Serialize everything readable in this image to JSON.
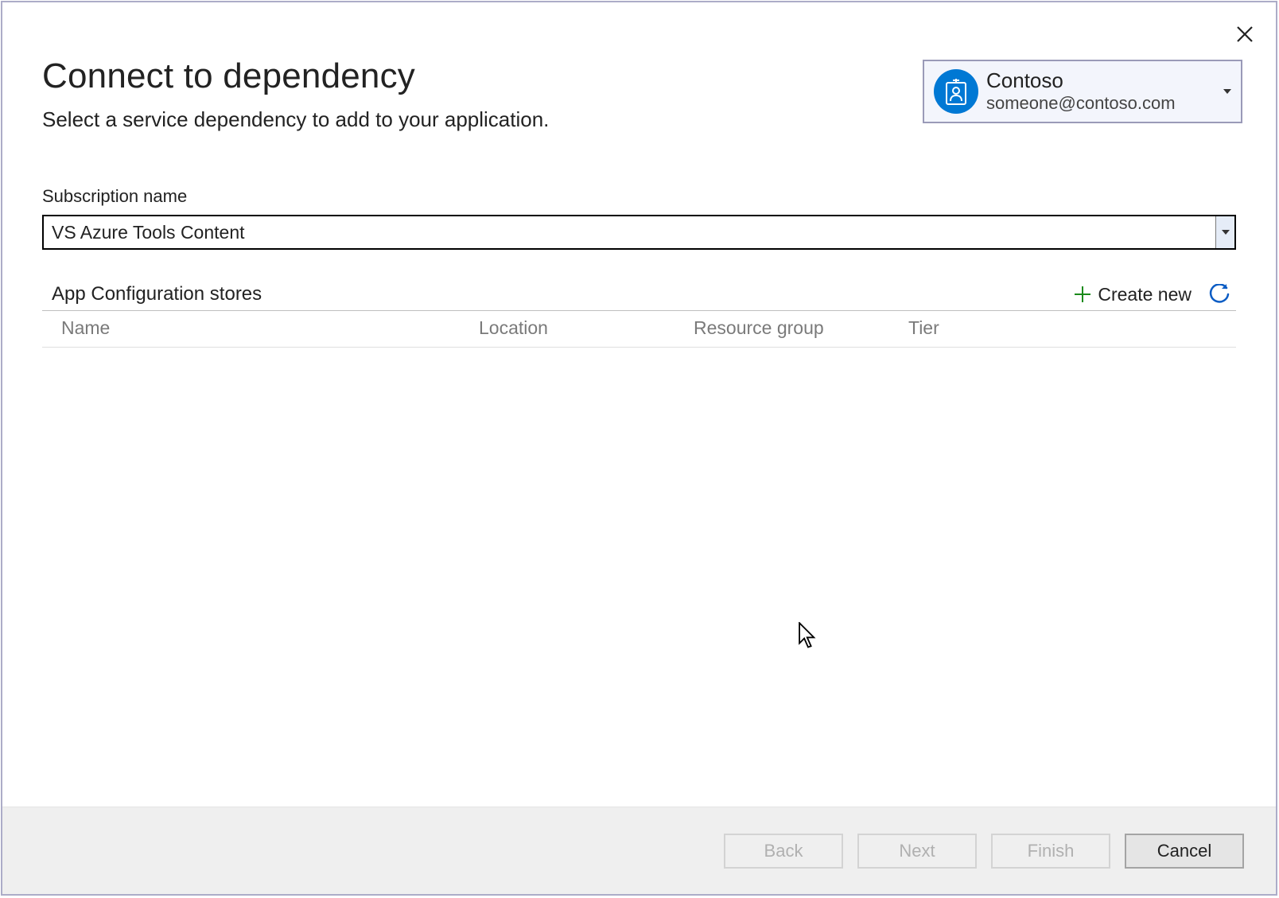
{
  "header": {
    "title": "Connect to dependency",
    "subtitle": "Select a service dependency to add to your application."
  },
  "account": {
    "name": "Contoso",
    "email": "someone@contoso.com"
  },
  "subscription": {
    "label": "Subscription name",
    "value": "VS Azure Tools Content"
  },
  "section": {
    "title": "App Configuration stores",
    "create_new": "Create new"
  },
  "table": {
    "columns": {
      "name": "Name",
      "location": "Location",
      "resource_group": "Resource group",
      "tier": "Tier"
    }
  },
  "footer": {
    "back": "Back",
    "next": "Next",
    "finish": "Finish",
    "cancel": "Cancel"
  }
}
